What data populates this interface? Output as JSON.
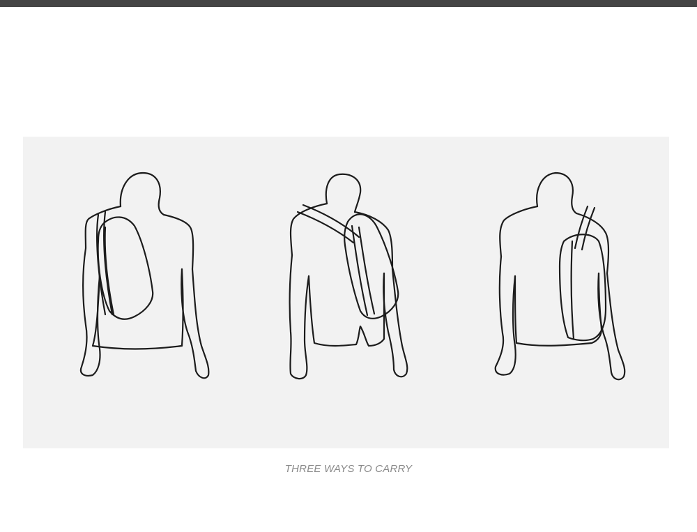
{
  "header": {
    "bar_color": "#454545"
  },
  "illustration": {
    "background": "#f2f2f2",
    "figures": [
      {
        "name": "figure-sling-left-shoulder"
      },
      {
        "name": "figure-crossbody-front"
      },
      {
        "name": "figure-backpack-shoulder"
      }
    ]
  },
  "caption": {
    "text": "THREE WAYS TO CARRY",
    "color": "#8a8a8a"
  }
}
